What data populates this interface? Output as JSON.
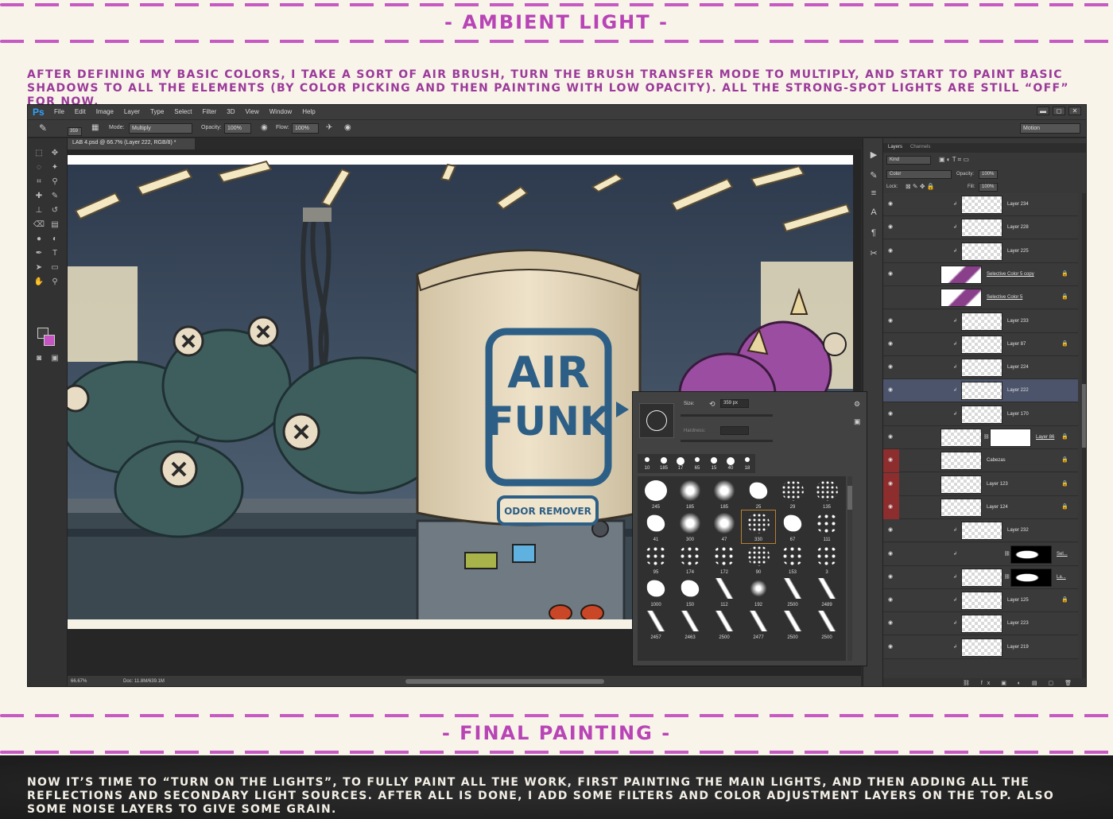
{
  "section1": {
    "title": "Ambient Light",
    "dash_left": "-",
    "dash_right": "-",
    "text": "After defining my basic colors, I take a sort of air brush, turn the brush transfer mode to multiply, and start to paint basic shadows to all the elements (by color picking and then painting with low opacity). All the strong-spot lights are still “off” for now."
  },
  "section2": {
    "title": "Final Painting",
    "dash_left": "-",
    "dash_right": "-",
    "text": "Now it’s time to “turn on the lights”, to fully paint all the work, first painting the main lights, and then adding all the reflections and secondary light sources. After all is done, I add some filters and color adjustment layers on the top. Also some noise layers to give some grain."
  },
  "colors": {
    "accent": "#c659c2",
    "heading": "#b844b6",
    "cream": "#f8f4ea",
    "selected_layer": "#4b546b",
    "ps_blue": "#2fa3ff"
  },
  "photoshop": {
    "logo": "Ps",
    "menu": [
      "File",
      "Edit",
      "Image",
      "Layer",
      "Type",
      "Select",
      "Filter",
      "3D",
      "View",
      "Window",
      "Help"
    ],
    "window_buttons": [
      "▬",
      "◻",
      "✕"
    ],
    "options": {
      "brush_size": "359",
      "mode_label": "Mode:",
      "mode_value": "Multiply",
      "opacity_label": "Opacity:",
      "opacity_value": "100%",
      "flow_label": "Flow:",
      "flow_value": "100%",
      "workspace": "Motion"
    },
    "doc_tab": "LAB 4.psd @ 66.7% (Layer 222, RGB/8) *",
    "status": {
      "zoom": "66.67%",
      "doc": "Doc: 11.8M/639.1M"
    },
    "artwork": {
      "logo_line1": "AIR",
      "logo_line2": "FUNK",
      "label": "ODOR REMOVER"
    },
    "brush_panel": {
      "size_label": "Size:",
      "size_value": "359 px",
      "hardness_label": "Hardness:",
      "recent": [
        "10",
        "185",
        "17",
        "65",
        "15",
        "40",
        "18"
      ],
      "presets": [
        {
          "num": "245",
          "kind": "hard"
        },
        {
          "num": "185",
          "kind": "soft"
        },
        {
          "num": "185",
          "kind": "soft"
        },
        {
          "num": "25",
          "kind": "shape"
        },
        {
          "num": "29",
          "kind": "speckle"
        },
        {
          "num": "135",
          "kind": "speckle"
        },
        {
          "num": "41",
          "kind": "shape"
        },
        {
          "num": "300",
          "kind": "soft"
        },
        {
          "num": "47",
          "kind": "soft"
        },
        {
          "num": "330",
          "kind": "speckle"
        },
        {
          "num": "67",
          "kind": "shape"
        },
        {
          "num": "111",
          "kind": "dots"
        },
        {
          "num": "95",
          "kind": "dots"
        },
        {
          "num": "174",
          "kind": "dots"
        },
        {
          "num": "172",
          "kind": "dots"
        },
        {
          "num": "90",
          "kind": "speckle"
        },
        {
          "num": "153",
          "kind": "dots"
        },
        {
          "num": "3",
          "kind": "dots"
        },
        {
          "num": "1000",
          "kind": "shape"
        },
        {
          "num": "150",
          "kind": "shape"
        },
        {
          "num": "112",
          "kind": "stroke"
        },
        {
          "num": "192",
          "kind": "star"
        },
        {
          "num": "2500",
          "kind": "stroke"
        },
        {
          "num": "2489",
          "kind": "stroke"
        },
        {
          "num": "2457",
          "kind": "stroke"
        },
        {
          "num": "2463",
          "kind": "stroke"
        },
        {
          "num": "2500",
          "kind": "stroke"
        },
        {
          "num": "2477",
          "kind": "stroke"
        },
        {
          "num": "2500",
          "kind": "stroke"
        },
        {
          "num": "2500",
          "kind": "stroke"
        }
      ]
    },
    "layers_panel": {
      "tabs": [
        "Layers",
        "Channels"
      ],
      "kind_label": "Kind",
      "blend_value": "Color",
      "opacity_label": "Opacity:",
      "opacity_value": "100%",
      "lock_label": "Lock:",
      "fill_label": "Fill:",
      "fill_value": "100%",
      "layers": [
        {
          "name": "Layer 234",
          "indent": 2,
          "thumb": "trans"
        },
        {
          "name": "Layer 228",
          "indent": 2,
          "thumb": "trans"
        },
        {
          "name": "Layer 225",
          "indent": 2,
          "thumb": "trans"
        },
        {
          "name": "Selective Color 5 copy",
          "indent": 1,
          "thumb": "purple",
          "lock": true
        },
        {
          "name": "Selective Color 5",
          "indent": 1,
          "thumb": "purple",
          "lock": true,
          "hidden": true
        },
        {
          "name": "Layer 233",
          "indent": 2,
          "thumb": "trans"
        },
        {
          "name": "Layer 87",
          "indent": 2,
          "thumb": "trans",
          "lock": true
        },
        {
          "name": "Layer 224",
          "indent": 2,
          "thumb": "trans"
        },
        {
          "name": "Layer 222",
          "indent": 2,
          "thumb": "trans",
          "selected": true
        },
        {
          "name": "Layer 170",
          "indent": 2,
          "thumb": "trans"
        },
        {
          "name": "Layer 86",
          "indent": 1,
          "thumb": "trans",
          "mask": "white",
          "lock": true
        },
        {
          "name": "Cabezas",
          "indent": 0,
          "thumb": "trans",
          "red": true,
          "lock": true
        },
        {
          "name": "Layer 123",
          "indent": 0,
          "thumb": "trans",
          "red": true,
          "lock": true
        },
        {
          "name": "Layer 124",
          "indent": 0,
          "thumb": "trans",
          "red": true,
          "lock": true
        },
        {
          "name": "Layer 232",
          "indent": 2,
          "thumb": "trans"
        },
        {
          "name": "Sel...",
          "indent": 3,
          "thumb": "adj",
          "mask": "black"
        },
        {
          "name": "La...",
          "indent": 2,
          "thumb": "trans",
          "mask": "black"
        },
        {
          "name": "Layer 125",
          "indent": 2,
          "thumb": "trans",
          "lock": true
        },
        {
          "name": "Layer 223",
          "indent": 2,
          "thumb": "trans"
        },
        {
          "name": "Layer 219",
          "indent": 2,
          "thumb": "trans"
        }
      ]
    }
  }
}
